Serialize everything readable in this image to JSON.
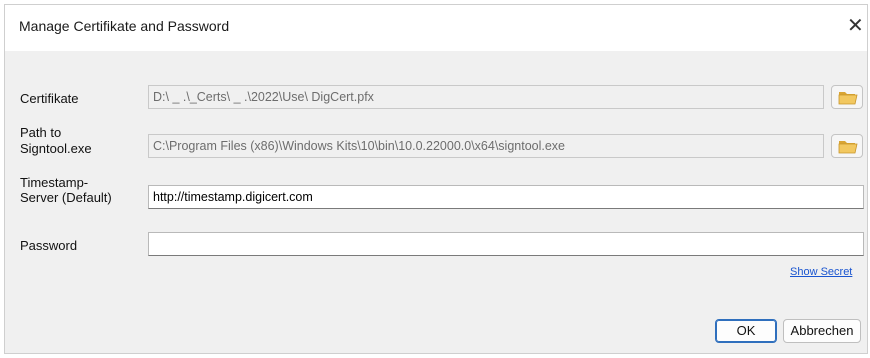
{
  "window": {
    "title": "Manage Certifikate and Password",
    "close_glyph": "✕"
  },
  "fields": {
    "certificate": {
      "label": "Certifikate",
      "value": "D:\\         _        .\\_Certs\\   _     .\\2022\\Use\\                    DigCert.pfx",
      "browse_icon": "folder-open-icon"
    },
    "signtool": {
      "label_line1": "Path to",
      "label_line2": "Signtool.exe",
      "value": "C:\\Program Files (x86)\\Windows Kits\\10\\bin\\10.0.22000.0\\x64\\signtool.exe",
      "browse_icon": "folder-open-icon"
    },
    "timestamp": {
      "label_line1": "Timestamp-",
      "label_line2": "Server (Default)",
      "value": "http://timestamp.digicert.com"
    },
    "password": {
      "label": "Password",
      "value": ""
    }
  },
  "show_secret_link": "Show Secret",
  "buttons": {
    "ok": "OK",
    "cancel": "Abbrechen"
  },
  "colors": {
    "link": "#1a55d0",
    "primary_border": "#2f6fbd",
    "folder": "#e8b84a"
  }
}
